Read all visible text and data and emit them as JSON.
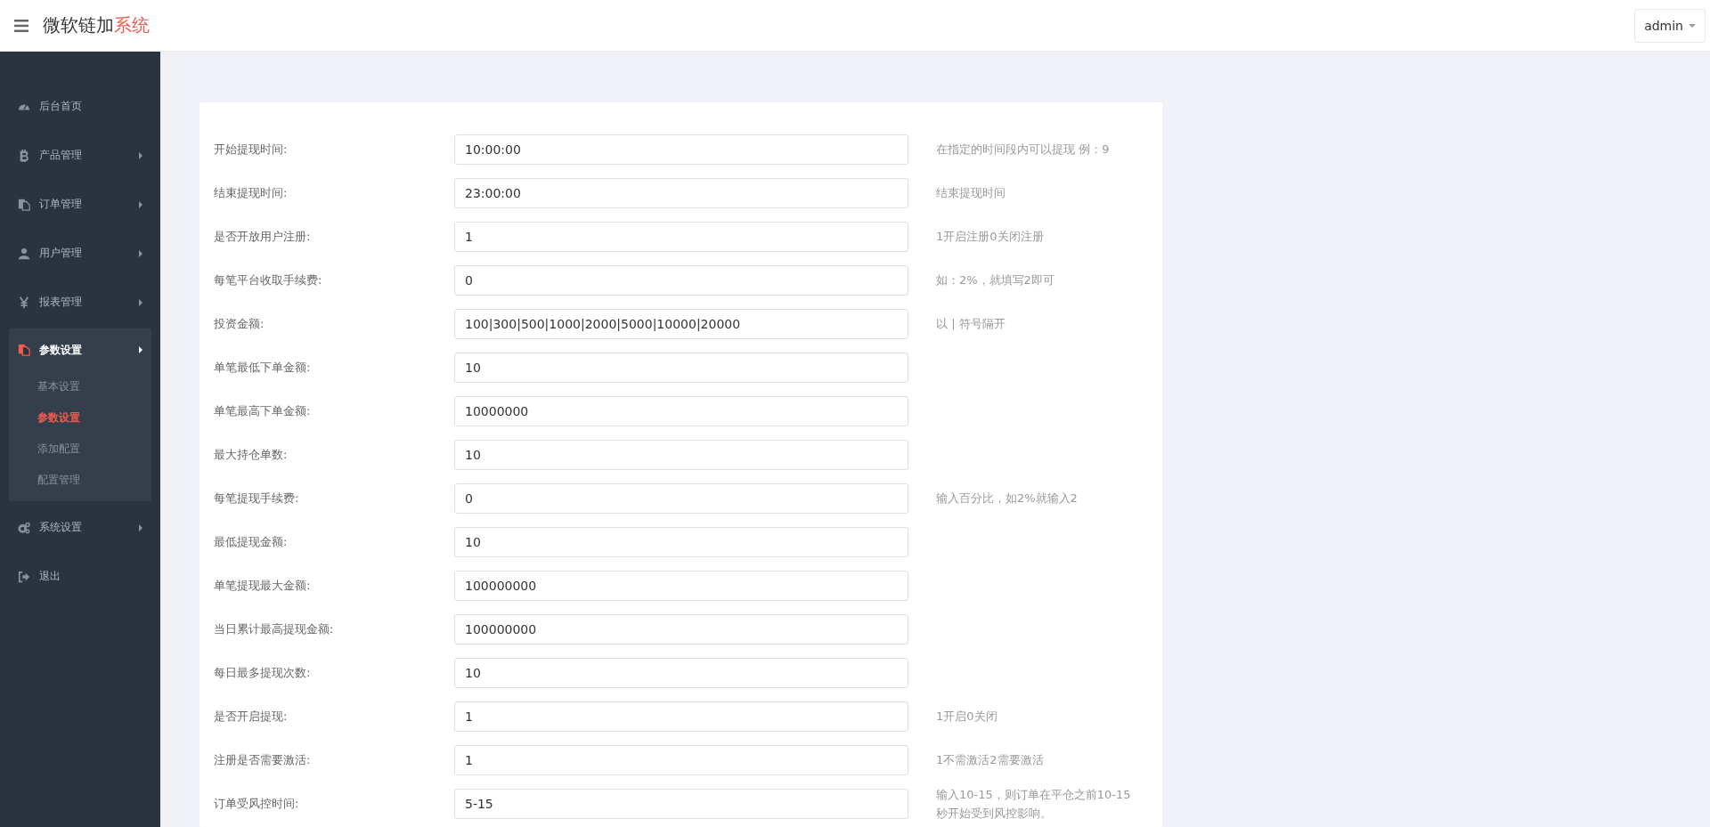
{
  "header": {
    "title": "微软链加",
    "title_accent": "系统",
    "user_menu": "admin"
  },
  "sidebar": {
    "items": [
      {
        "label": "后台首页",
        "has_arrow": false,
        "expanded": false
      },
      {
        "label": "产品管理",
        "has_arrow": true,
        "expanded": false
      },
      {
        "label": "订单管理",
        "has_arrow": true,
        "expanded": false
      },
      {
        "label": "用户管理",
        "has_arrow": true,
        "expanded": false
      },
      {
        "label": "报表管理",
        "has_arrow": true,
        "expanded": false
      },
      {
        "label": "参数设置",
        "has_arrow": true,
        "expanded": true,
        "children": [
          {
            "label": "基本设置",
            "selected": false
          },
          {
            "label": "参数设置",
            "selected": true
          },
          {
            "label": "添加配置",
            "selected": false
          },
          {
            "label": "配置管理",
            "selected": false
          }
        ]
      },
      {
        "label": "系统设置",
        "has_arrow": true,
        "expanded": false
      },
      {
        "label": "退出",
        "has_arrow": false,
        "expanded": false
      }
    ]
  },
  "form": {
    "rows": [
      {
        "label": "开始提现时间:",
        "value": "10:00:00",
        "hint": "在指定的时间段内可以提现 例：9"
      },
      {
        "label": "结束提现时间:",
        "value": "23:00:00",
        "hint": "结束提现时间"
      },
      {
        "label": "是否开放用户注册:",
        "value": "1",
        "hint": "1开启注册0关闭注册"
      },
      {
        "label": "每笔平台收取手续费:",
        "value": "0",
        "hint": "如：2%，就填写2即可"
      },
      {
        "label": "投资金额:",
        "value": "100|300|500|1000|2000|5000|10000|20000",
        "hint": "以 | 符号隔开"
      },
      {
        "label": "单笔最低下单金额:",
        "value": "10"
      },
      {
        "label": "单笔最高下单金额:",
        "value": "10000000"
      },
      {
        "label": "最大持仓单数:",
        "value": "10"
      },
      {
        "label": "每笔提现手续费:",
        "value": "0",
        "hint": "输入百分比，如2%就输入2"
      },
      {
        "label": "最低提现金额:",
        "value": "10"
      },
      {
        "label": "单笔提现最大金额:",
        "value": "100000000"
      },
      {
        "label": "当日累计最高提现金额:",
        "value": "100000000"
      },
      {
        "label": "每日最多提现次数:",
        "value": "10"
      },
      {
        "label": "是否开启提现:",
        "value": "1",
        "hint": "1开启0关闭"
      },
      {
        "label": "注册是否需要激活:",
        "value": "1",
        "hint": "1不需激活2需要激活"
      },
      {
        "label": "订单受风控时间:",
        "value": "5-15",
        "hint": "输入10-15，则订单在平仓之前10-15秒开始受到风控影响。"
      }
    ]
  }
}
